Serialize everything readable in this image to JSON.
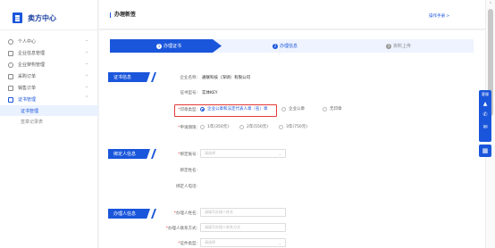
{
  "sidebar": {
    "title": "卖方中心",
    "items": [
      {
        "label": "个人中心",
        "icon": "user-icon"
      },
      {
        "label": "企业信息管理",
        "icon": "building-icon"
      },
      {
        "label": "企业架构管理",
        "icon": "org-icon"
      },
      {
        "label": "采购订单",
        "icon": "purchase-order-icon"
      },
      {
        "label": "销售订单",
        "icon": "sales-order-icon"
      },
      {
        "label": "证书管理",
        "icon": "certificate-icon"
      }
    ],
    "subitems": [
      {
        "label": "证书管理"
      },
      {
        "label": "签章记录表"
      }
    ]
  },
  "header": {
    "title": "办理新签",
    "manual_link": "操作手册 >"
  },
  "steps": [
    {
      "num": "1",
      "label": "办理证书"
    },
    {
      "num": "2",
      "label": "办理信息"
    },
    {
      "num": "3",
      "label": "资料上传"
    }
  ],
  "cert_section": {
    "tag": "证书信息",
    "company_label": "企业名称:",
    "company_value": "通联科技（深圳）有限公司",
    "cert_type_label": "证书型号:",
    "cert_type_value": "实体KEY",
    "seal_type_label": "印章类型:",
    "seal_options": [
      "企业公章和法定代表人章（名）章",
      "企业公章",
      "无印章"
    ],
    "period_label": "申请期限:",
    "period_options": [
      "1年(350元)",
      "2年(550元)",
      "3年(750元)"
    ]
  },
  "binder_section": {
    "tag": "绑定人信息",
    "account_label": "绑定账号:",
    "account_placeholder": "请选择",
    "name_label": "绑定姓名:",
    "phone_label": "绑定人电话:"
  },
  "handler_section": {
    "tag": "办理人信息",
    "name_label": "办理人姓名:",
    "name_placeholder": "请填写办理人姓名",
    "contact_label": "办理人联系方式:",
    "contact_placeholder": "请填写办理人联系方式",
    "id_type_label": "证件类型:",
    "id_type_placeholder": "请选择"
  },
  "float_bar": {
    "label": "客服"
  },
  "colors": {
    "accent": "#1a56db",
    "highlight": "#e53935"
  }
}
